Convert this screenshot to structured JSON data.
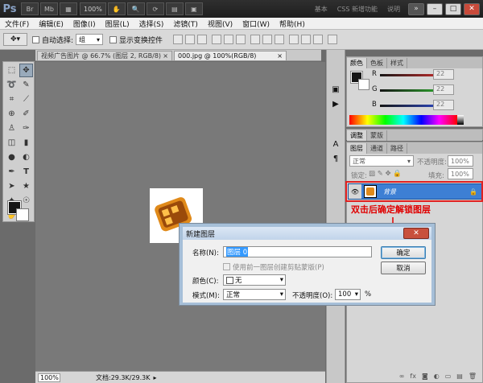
{
  "titlebar": {
    "logo": "Ps",
    "zoom": "100%",
    "workspaces": [
      "基本",
      "CSS 新增功能",
      "说明"
    ],
    "more": "»"
  },
  "menu": [
    "文件(F)",
    "编辑(E)",
    "图像(I)",
    "图层(L)",
    "选择(S)",
    "滤镜(T)",
    "视图(V)",
    "窗口(W)",
    "帮助(H)"
  ],
  "options": {
    "auto_select_label": "自动选择:",
    "auto_select_value": "组",
    "show_transform_label": "显示变换控件"
  },
  "tabs": [
    {
      "label": "视频广告图片 @ 66.7% (图层 2, RGB/8) *",
      "close": "×"
    },
    {
      "label": "000.jpg @ 100%(RGB/8)",
      "close": "×"
    }
  ],
  "status": {
    "zoom": "100%",
    "doc": "文档:29.3K/29.3K"
  },
  "color_panel": {
    "tabs": [
      "颜色",
      "色板",
      "样式"
    ],
    "channels": [
      {
        "letter": "R",
        "value": "22",
        "color": "#e03030"
      },
      {
        "letter": "G",
        "value": "22",
        "color": "#30c030"
      },
      {
        "letter": "B",
        "value": "22",
        "color": "#3050e0"
      }
    ]
  },
  "adjust_panel": {
    "tabs": [
      "调整",
      "蒙版"
    ]
  },
  "layers_panel": {
    "tabs": [
      "图层",
      "通道",
      "路径"
    ],
    "blend_mode": "正常",
    "opacity_label": "不透明度:",
    "opacity_value": "100%",
    "lock_label": "锁定:",
    "fill_label": "填充:",
    "fill_value": "100%",
    "layer_name": "背景"
  },
  "annotation": "双击后确定解锁图层",
  "dialog": {
    "title": "新建图层",
    "close": "✕",
    "name_label": "名称(N):",
    "name_value": "图层 0",
    "clip_label": "使用前一图层创建剪贴蒙版(P)",
    "color_label": "颜色(C):",
    "color_value": "无",
    "mode_label": "模式(M):",
    "mode_value": "正常",
    "opacity_label": "不透明度(O):",
    "opacity_value": "100",
    "percent": "%",
    "ok": "确定",
    "cancel": "取消"
  },
  "colors": {
    "accent_red": "#e00000",
    "selected_layer": "#3d7fd4"
  }
}
